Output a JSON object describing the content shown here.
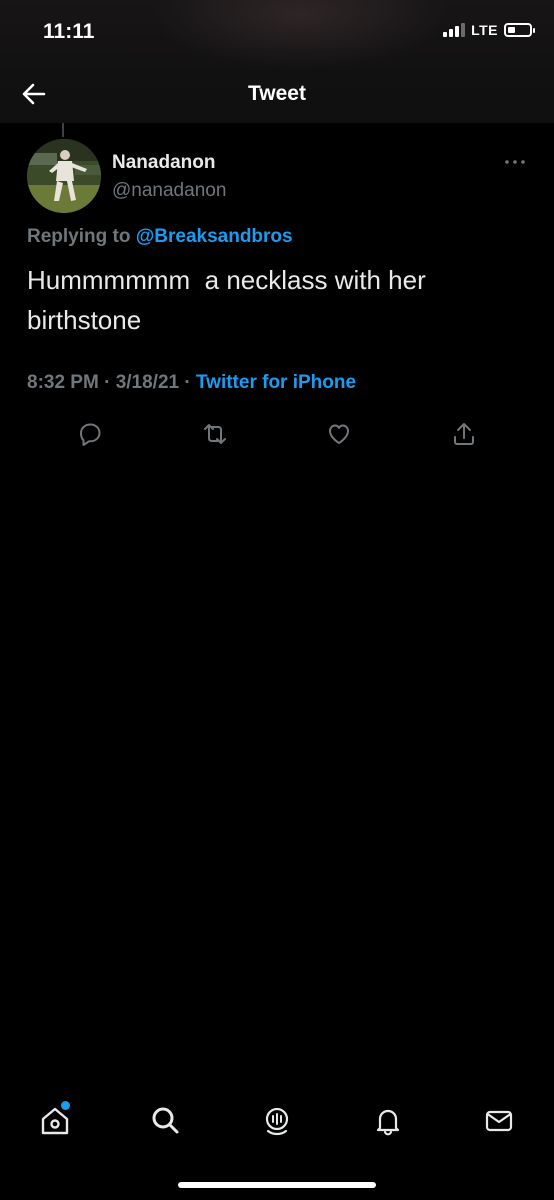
{
  "status_bar": {
    "time": "11:11",
    "network": "LTE"
  },
  "header": {
    "title": "Tweet"
  },
  "tweet": {
    "author_name": "Nanadanon",
    "author_handle": "@nanadanon",
    "replying_label": "Replying to",
    "replying_to": "@Breaksandbros",
    "text": "Hummmmmm  a necklass with her birthstone",
    "time_date": "8:32 PM · 3/18/21 · ",
    "source": "Twitter for iPhone"
  },
  "actions": [
    "reply-icon",
    "retweet-icon",
    "like-icon",
    "share-icon"
  ],
  "tabbar": [
    "home-icon",
    "search-icon",
    "spaces-icon",
    "notifications-icon",
    "messages-icon"
  ],
  "colors": {
    "background": "#000000",
    "accent": "#1d9bf0",
    "secondary_text": "#71767b"
  }
}
